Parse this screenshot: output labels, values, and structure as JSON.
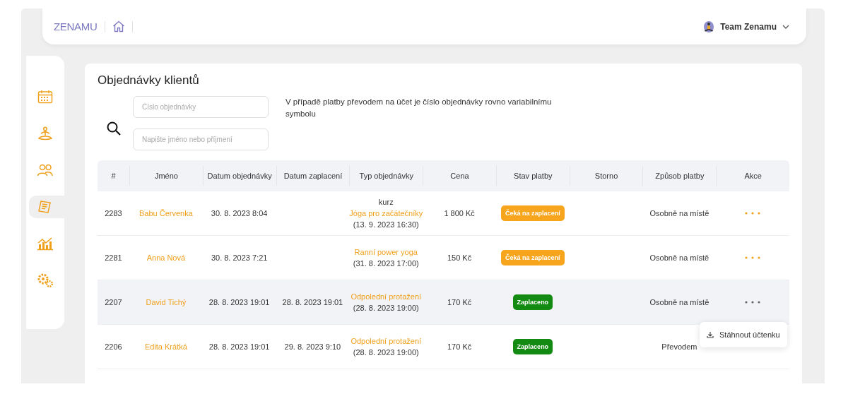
{
  "header": {
    "logo": "ZENAMU",
    "user": "Team Zenamu"
  },
  "sidebar": {
    "items": [
      {
        "selected": false
      },
      {
        "selected": false
      },
      {
        "selected": false
      },
      {
        "selected": true
      },
      {
        "selected": false
      },
      {
        "selected": false
      }
    ]
  },
  "page": {
    "title": "Objednávky klientů",
    "order_number_placeholder": "Číslo objednávky",
    "name_placeholder": "Napište jméno nebo příjmení",
    "note": "V případě platby převodem na účet je číslo objednávky rovno variabilnímu symbolu"
  },
  "table": {
    "columns": [
      "#",
      "Jméno",
      "Datum objednávky",
      "Datum zaplacení",
      "Typ objednávky",
      "Cena",
      "Stav platby",
      "Storno",
      "Způsob platby",
      "Akce"
    ],
    "rows": [
      {
        "id": "2283",
        "name": "Babu Červenka",
        "ordered": "30. 8. 2023 8:04",
        "paid": "",
        "type_prefix": "kurz ",
        "type_link": "Jóga pro začátečníky",
        "type_suffix": " (13. 9. 2023 16:30)",
        "price": "1 800 Kč",
        "status": {
          "kind": "pending",
          "label": "Čeká na zaplacení"
        },
        "method": "Osobně na místě",
        "selected": false,
        "actions_visible": true
      },
      {
        "id": "2281",
        "name": "Anna Nová",
        "ordered": "30. 8. 2023 7:21",
        "paid": "",
        "type_prefix": "",
        "type_link": "Ranní power yoga",
        "type_suffix": " (31. 8. 2023 17:00)",
        "price": "150 Kč",
        "status": {
          "kind": "pending",
          "label": "Čeká na zaplacení"
        },
        "method": "Osobně na místě",
        "selected": false,
        "actions_visible": true
      },
      {
        "id": "2207",
        "name": "David Tichý",
        "ordered": "28. 8. 2023 19:01",
        "paid": "28. 8. 2023 19:01",
        "type_prefix": "",
        "type_link": "Odpolední protažení",
        "type_suffix": " (28. 8. 2023 19:00)",
        "price": "170 Kč",
        "status": {
          "kind": "paid",
          "label": "Zaplaceno"
        },
        "method": "Osobně na místě",
        "selected": true,
        "actions_visible": true
      },
      {
        "id": "2206",
        "name": "Edita Krátká",
        "ordered": "28. 8. 2023 19:01",
        "paid": "29. 8. 2023 9:10",
        "type_prefix": "",
        "type_link": "Odpolední protažení",
        "type_suffix": " (28. 8. 2023 19:00)",
        "price": "170 Kč",
        "status": {
          "kind": "paid",
          "label": "Zaplaceno"
        },
        "method": "Převodem",
        "selected": false,
        "actions_visible": false
      }
    ]
  },
  "action_menu": {
    "items": [
      "Stáhnout účtenku"
    ]
  }
}
